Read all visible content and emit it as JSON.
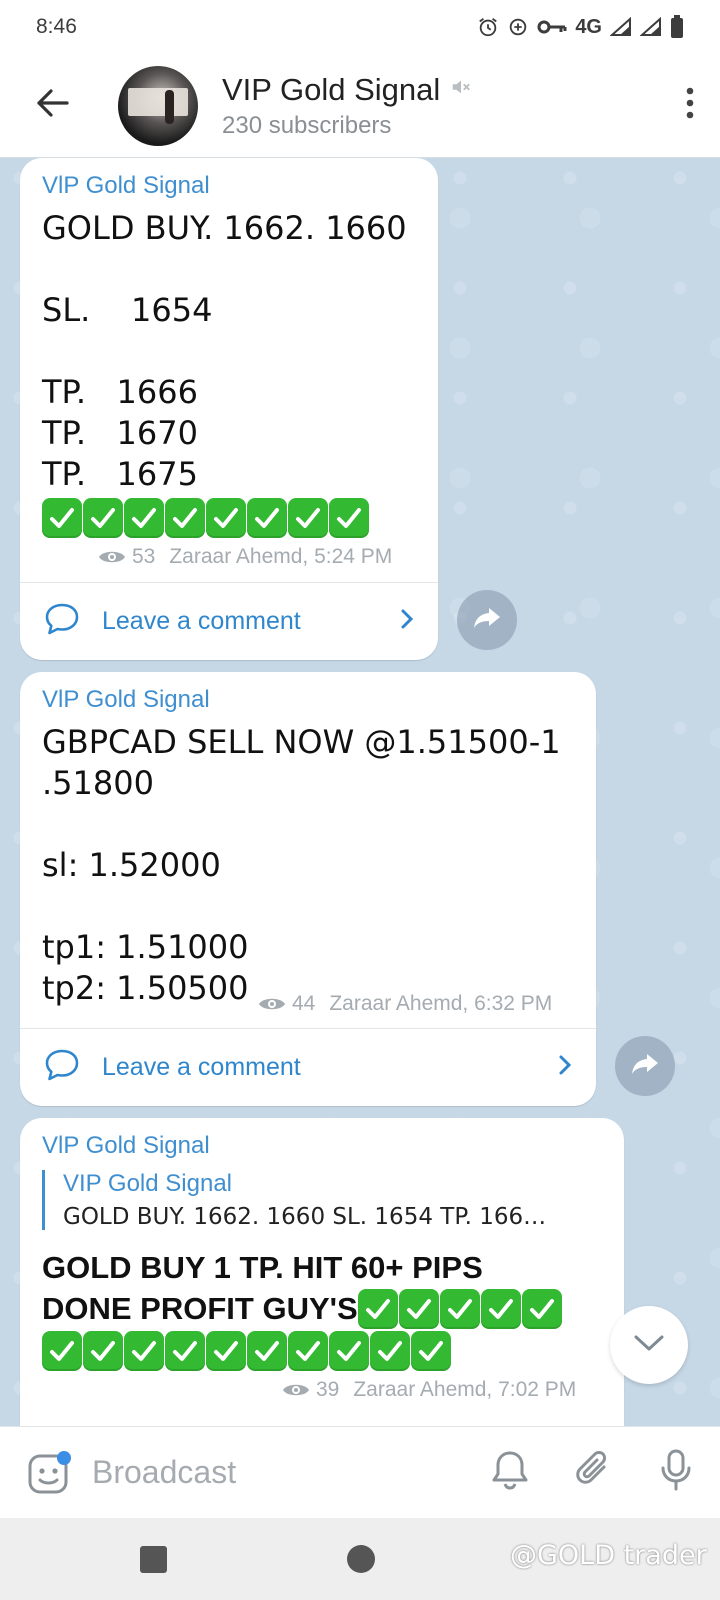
{
  "status_bar": {
    "time": "8:46",
    "network": "4G"
  },
  "header": {
    "title": "VIP Gold Signal",
    "subtitle": "230 subscribers",
    "muted": true
  },
  "messages": [
    {
      "sender": "VlP Gold Signal",
      "text": "GOLD BUY. 1662. 1660\n\nSL.    1654\n\nTP.   1666\nTP.   1670\nTP.   1675",
      "check_count": 8,
      "views": "53",
      "author_time": "Zaraar Ahemd, 5:24 PM",
      "comment_label": "Leave a comment"
    },
    {
      "sender": "VlP Gold Signal",
      "text": "GBPCAD SELL NOW @1.51500-1\n.51800\n\nsl: 1.52000\n\ntp1: 1.51000\ntp2: 1.50500",
      "views": "44",
      "author_time": "Zaraar Ahemd, 6:32 PM",
      "comment_label": "Leave a comment"
    },
    {
      "sender": "VlP Gold Signal",
      "reply_name": "VIP Gold Signal",
      "reply_text": "GOLD BUY. 1662. 1660  SL.    1654  TP.   166…",
      "text_line1": "GOLD BUY 1 TP. HIT 60+ PIPS",
      "text_line2": "DONE PROFIT GUY'S",
      "inline_check_count": 5,
      "check_row_count": 10,
      "views": "39",
      "author_time": "Zaraar Ahemd, 7:02 PM"
    }
  ],
  "input": {
    "placeholder": "Broadcast"
  },
  "watermark": "@GOLD trader",
  "colors": {
    "accent": "#3f8fd0",
    "check_green": "#33b932",
    "chat_bg": "#c6d7e6"
  }
}
